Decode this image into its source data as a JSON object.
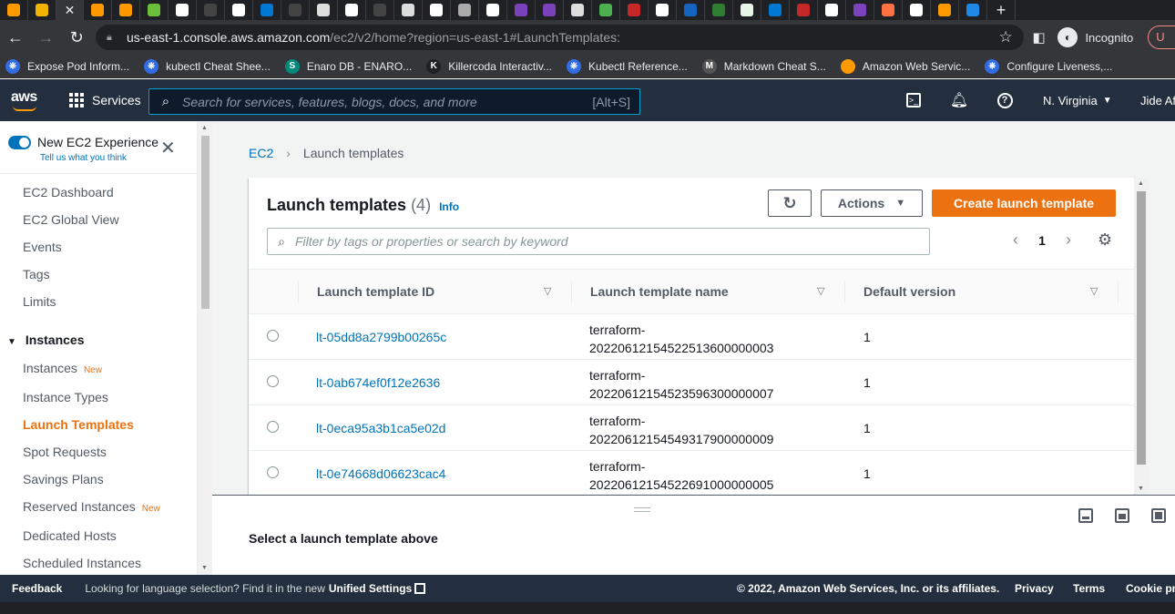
{
  "browser": {
    "tabs": [
      {
        "name": "aws-tab-1",
        "color": "#ff9900",
        "glyph": ""
      },
      {
        "name": "aws-tab-2",
        "color": "#f0b400",
        "glyph": ""
      },
      {
        "name": "active-tab-close",
        "color": "",
        "glyph": "✕"
      },
      {
        "name": "aws-tab-3",
        "color": "#ff9900",
        "glyph": ""
      },
      {
        "name": "aws-tab-4",
        "color": "#ff9900",
        "glyph": ""
      },
      {
        "name": "git-tab",
        "color": "#6cbf3a",
        "glyph": ""
      },
      {
        "name": "google-tab-1",
        "color": "#ffffff",
        "glyph": ""
      },
      {
        "name": "tab-dark-1",
        "color": "#444444",
        "glyph": ""
      },
      {
        "name": "google-tab-2",
        "color": "#ffffff",
        "glyph": ""
      },
      {
        "name": "azure-tab",
        "color": "#0078d4",
        "glyph": ""
      },
      {
        "name": "github-tab-1",
        "color": "#444444",
        "glyph": ""
      },
      {
        "name": "tab-doc",
        "color": "#dddddd",
        "glyph": ""
      },
      {
        "name": "google-tab-3",
        "color": "#ffffff",
        "glyph": ""
      },
      {
        "name": "github-tab-2",
        "color": "#444444",
        "glyph": ""
      },
      {
        "name": "github-tab-3",
        "color": "#dddddd",
        "glyph": ""
      },
      {
        "name": "google-tab-4",
        "color": "#ffffff",
        "glyph": ""
      },
      {
        "name": "github-tab-4",
        "color": "#aaaaaa",
        "glyph": ""
      },
      {
        "name": "hashicorp-tab",
        "color": "#ffffff",
        "glyph": ""
      },
      {
        "name": "terraform-tab-1",
        "color": "#7b42bc",
        "glyph": ""
      },
      {
        "name": "terraform-tab-2",
        "color": "#7b42bc",
        "glyph": ""
      },
      {
        "name": "tab-vs",
        "color": "#dddddd",
        "glyph": ""
      },
      {
        "name": "download-tab",
        "color": "#4caf50",
        "glyph": ""
      },
      {
        "name": "tab-red",
        "color": "#c62828",
        "glyph": ""
      },
      {
        "name": "google-tab-5",
        "color": "#ffffff",
        "glyph": ""
      },
      {
        "name": "tab-blue-1",
        "color": "#1565c0",
        "glyph": ""
      },
      {
        "name": "tab-green",
        "color": "#2e7d32",
        "glyph": ""
      },
      {
        "name": "tab-white-green",
        "color": "#e8f5e9",
        "glyph": ""
      },
      {
        "name": "tab-azure-2",
        "color": "#0078d4",
        "glyph": ""
      },
      {
        "name": "tab-sei",
        "color": "#c62828",
        "glyph": ""
      },
      {
        "name": "tab-notion",
        "color": "#ffffff",
        "glyph": ""
      },
      {
        "name": "terraform-tab-3",
        "color": "#7b42bc",
        "glyph": ""
      },
      {
        "name": "tab-orange-ring",
        "color": "#ff7043",
        "glyph": ""
      },
      {
        "name": "google-tab-6",
        "color": "#ffffff",
        "glyph": ""
      },
      {
        "name": "aws-tab-5",
        "color": "#ff9900",
        "glyph": ""
      },
      {
        "name": "tab-docs-blue",
        "color": "#1e88e5",
        "glyph": ""
      },
      {
        "name": "new-tab",
        "color": "",
        "glyph": "+"
      }
    ],
    "url_host": "us-east-1.console.aws.amazon.com",
    "url_path": "/ec2/v2/home?region=us-east-1#LaunchTemplates:",
    "incognito_label": "Incognito",
    "profile_initial": "U",
    "bookmarks": [
      {
        "label": "Expose Pod Inform...",
        "color": "#326ce5",
        "glyph": "⎈"
      },
      {
        "label": "kubectl Cheat Shee...",
        "color": "#326ce5",
        "glyph": "⎈"
      },
      {
        "label": "Enaro DB - ENARO...",
        "color": "#00897b",
        "glyph": "S"
      },
      {
        "label": "Killercoda Interactiv...",
        "color": "#202124",
        "glyph": "K"
      },
      {
        "label": "Kubectl Reference...",
        "color": "#326ce5",
        "glyph": "⎈"
      },
      {
        "label": "Markdown Cheat S...",
        "color": "#555555",
        "glyph": "M"
      },
      {
        "label": "Amazon Web Servic...",
        "color": "#ff9900",
        "glyph": ""
      },
      {
        "label": "Configure Liveness,...",
        "color": "#326ce5",
        "glyph": "⎈"
      }
    ]
  },
  "aws": {
    "logo_text": "aws",
    "services_label": "Services",
    "search_placeholder": "Search for services, features, blogs, docs, and more",
    "search_shortcut": "[Alt+S]",
    "region": "N. Virginia",
    "username": "Jide Af"
  },
  "sidebar": {
    "experience_title": "New EC2 Experience",
    "experience_sub": "Tell us what you think",
    "items_top": [
      "EC2 Dashboard",
      "EC2 Global View",
      "Events",
      "Tags",
      "Limits"
    ],
    "group_instances": "Instances",
    "instances_items": [
      {
        "label": "Instances",
        "badge": "New"
      },
      {
        "label": "Instance Types",
        "badge": ""
      },
      {
        "label": "Launch Templates",
        "badge": ""
      },
      {
        "label": "Spot Requests",
        "badge": ""
      },
      {
        "label": "Savings Plans",
        "badge": ""
      },
      {
        "label": "Reserved Instances",
        "badge": "New"
      },
      {
        "label": "Dedicated Hosts",
        "badge": ""
      },
      {
        "label": "Scheduled Instances",
        "badge": ""
      }
    ],
    "active_item": "Launch Templates"
  },
  "main": {
    "breadcrumb": {
      "root": "EC2",
      "current": "Launch templates"
    },
    "title": "Launch templates",
    "count": "(4)",
    "info": "Info",
    "actions_label": "Actions",
    "create_label": "Create launch template",
    "filter_placeholder": "Filter by tags or properties or search by keyword",
    "page": "1",
    "columns": [
      "Launch template ID",
      "Launch template name",
      "Default version"
    ],
    "rows": [
      {
        "id": "lt-05dd8a2799b00265c",
        "name_1": "terraform-",
        "name_2": "20220612154522513600000003",
        "version": "1"
      },
      {
        "id": "lt-0ab674ef0f12e2636",
        "name_1": "terraform-",
        "name_2": "20220612154523596300000007",
        "version": "1"
      },
      {
        "id": "lt-0eca95a3b1ca5e02d",
        "name_1": "terraform-",
        "name_2": "20220612154549317900000009",
        "version": "1"
      },
      {
        "id": "lt-0e74668d06623cac4",
        "name_1": "terraform-",
        "name_2": "20220612154522691000000005",
        "version": "1"
      }
    ]
  },
  "detail": {
    "title": "Select a launch template above"
  },
  "footer": {
    "feedback": "Feedback",
    "lang_text": "Looking for language selection? Find it in the new",
    "unified": "Unified Settings",
    "copyright": "© 2022, Amazon Web Services, Inc. or its affiliates.",
    "privacy": "Privacy",
    "terms": "Terms",
    "cookie": "Cookie pre"
  }
}
